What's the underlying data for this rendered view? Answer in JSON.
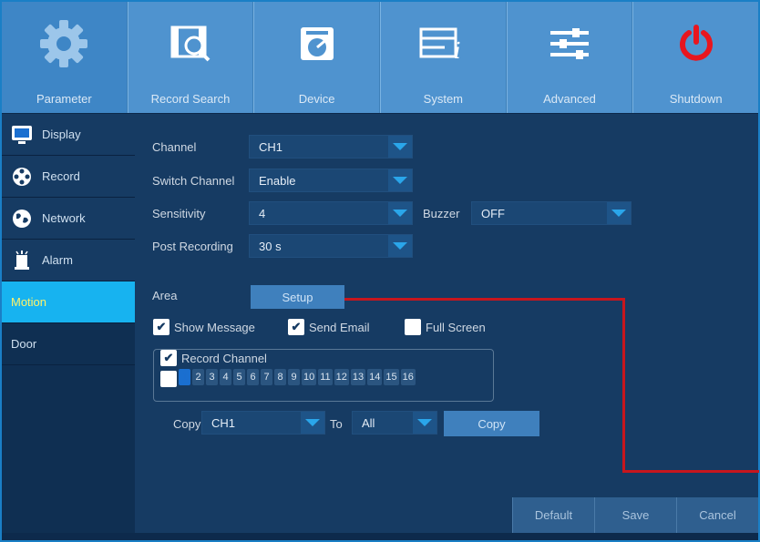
{
  "toolbar": {
    "items": [
      {
        "label": "Parameter",
        "icon": "gear-icon"
      },
      {
        "label": "Record Search",
        "icon": "record-search-icon"
      },
      {
        "label": "Device",
        "icon": "device-icon"
      },
      {
        "label": "System",
        "icon": "system-icon"
      },
      {
        "label": "Advanced",
        "icon": "advanced-icon"
      },
      {
        "label": "Shutdown",
        "icon": "power-icon"
      }
    ]
  },
  "sidebar": {
    "items": [
      {
        "label": "Display",
        "icon": "monitor-icon"
      },
      {
        "label": "Record",
        "icon": "film-reel-icon"
      },
      {
        "label": "Network",
        "icon": "globe-icon"
      },
      {
        "label": "Alarm",
        "icon": "alarm-bell-icon"
      },
      {
        "label": "Motion"
      },
      {
        "label": "Door"
      }
    ]
  },
  "form": {
    "channel_label": "Channel",
    "channel_value": "CH1",
    "switch_channel_label": "Switch Channel",
    "switch_channel_value": "Enable",
    "sensitivity_label": "Sensitivity",
    "sensitivity_value": "4",
    "buzzer_label": "Buzzer",
    "buzzer_value": "OFF",
    "post_recording_label": "Post Recording",
    "post_recording_value": "30 s",
    "area_label": "Area",
    "setup_label": "Setup",
    "show_message_label": "Show Message",
    "send_email_label": "Send Email",
    "full_screen_label": "Full Screen",
    "record_channel_label": "Record Channel",
    "channels": [
      "1",
      "2",
      "3",
      "4",
      "5",
      "6",
      "7",
      "8",
      "9",
      "10",
      "11",
      "12",
      "13",
      "14",
      "15",
      "16"
    ],
    "copy_label": "Copy",
    "copy_from_value": "CH1",
    "to_label": "To",
    "copy_to_value": "All",
    "copy_button_label": "Copy"
  },
  "footer": {
    "default_label": "Default",
    "save_label": "Save",
    "cancel_label": "Cancel"
  },
  "colors": {
    "accent": "#17b3f0",
    "highlight_text": "#fff26a",
    "power": "#e8161f",
    "annotation_line": "#c7161d"
  }
}
